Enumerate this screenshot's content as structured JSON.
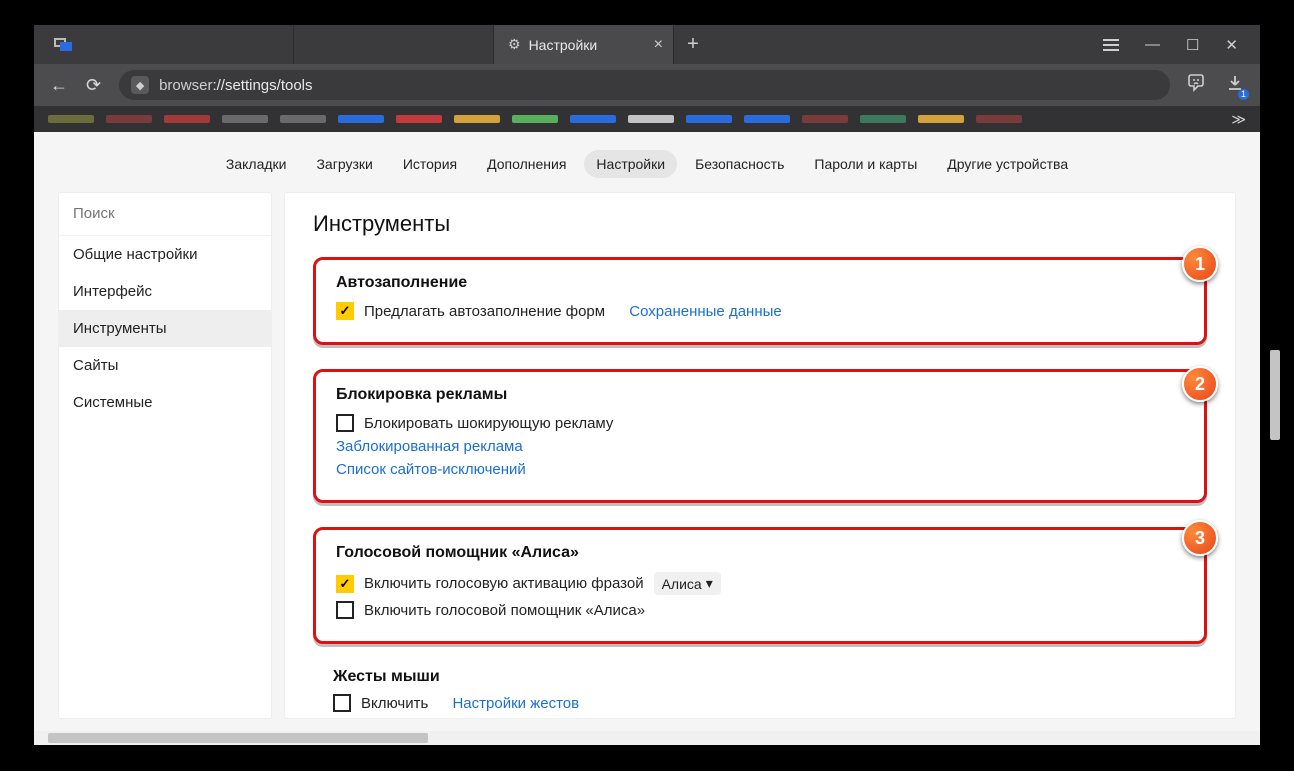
{
  "tab": {
    "title": "Настройки"
  },
  "url": {
    "host": "browser",
    "path": "://settings/tools"
  },
  "download_badge": "1",
  "topmenu": [
    "Закладки",
    "Загрузки",
    "История",
    "Дополнения",
    "Настройки",
    "Безопасность",
    "Пароли и карты",
    "Другие устройства"
  ],
  "topmenu_active": 4,
  "sidebar": {
    "search_placeholder": "Поиск",
    "items": [
      "Общие настройки",
      "Интерфейс",
      "Инструменты",
      "Сайты",
      "Системные"
    ],
    "active": 2
  },
  "page_title": "Инструменты",
  "sec_autofill": {
    "title": "Автозаполнение",
    "opt": "Предлагать автозаполнение форм",
    "link": "Сохраненные данные"
  },
  "sec_adblock": {
    "title": "Блокировка рекламы",
    "opt": "Блокировать шокирующую рекламу",
    "link1": "Заблокированная реклама",
    "link2": "Список сайтов-исключений"
  },
  "sec_alice": {
    "title": "Голосовой помощник «Алиса»",
    "opt1": "Включить голосовую активацию фразой",
    "select_value": "Алиса",
    "opt2": "Включить голосовой помощник «Алиса»"
  },
  "sec_mouse": {
    "title": "Жесты мыши",
    "opt": "Включить",
    "link": "Настройки жестов"
  },
  "callouts": {
    "c1": "1",
    "c2": "2",
    "c3": "3"
  },
  "bookbar_colors": [
    "#6b6e3a",
    "#7a3b3b",
    "#a23a3a",
    "#6a6a6a",
    "#6a6a6a",
    "#2a6cdd",
    "#c23a3a",
    "#d1a33a",
    "#5ab05a",
    "#2a6cdd",
    "#c2c2c2",
    "#2a6cdd",
    "#2a6cdd",
    "#7a3b3b",
    "#3b7a5a",
    "#d1a33a",
    "#7a3b3b"
  ]
}
